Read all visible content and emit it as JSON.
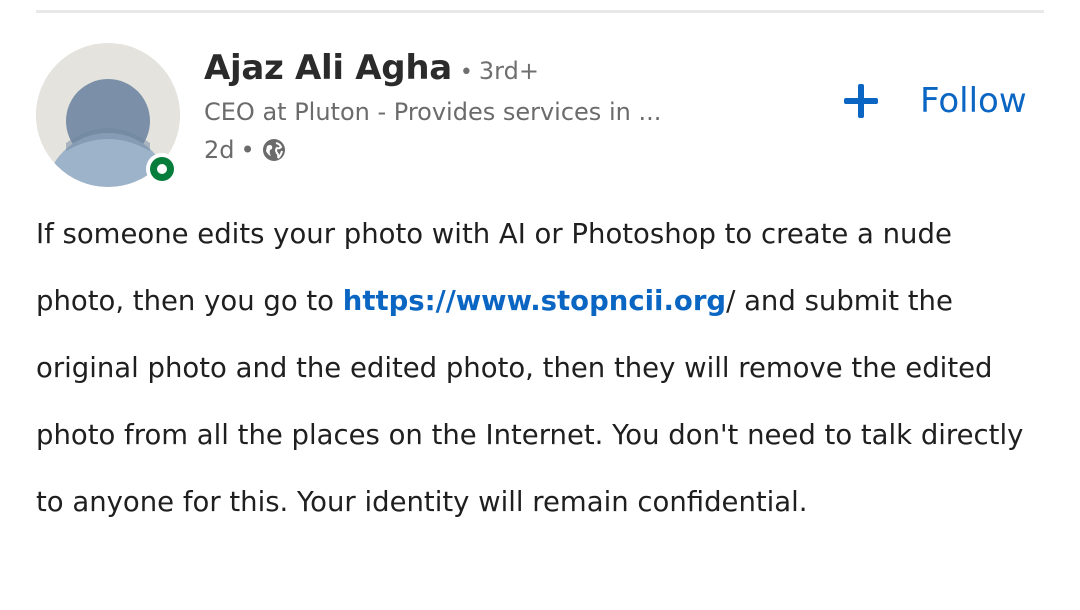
{
  "post": {
    "author": {
      "name": "Ajaz Ali Agha",
      "degree_separator": "•",
      "degree": "3rd+",
      "headline": "CEO at Pluton - Provides services in ...",
      "time_ago": "2d",
      "time_separator": "•",
      "visibility_icon": "globe-icon",
      "presence_status": "online"
    },
    "follow": {
      "icon": "plus-icon",
      "label": "Follow"
    },
    "body": {
      "text_before_link": "If someone edits your photo with AI or Photoshop to create a nude photo, then you go to ",
      "link_text": "https://www.stopncii.org",
      "text_after_link": "/ and submit the original photo and the edited photo, then they will remove the edited photo from all the places on the Internet. You don't need to talk directly to anyone for this. Your identity will remain confidential."
    }
  },
  "colors": {
    "link": "#0a66c2",
    "presence": "#067d3a",
    "avatar_bg": "#e5e3de"
  }
}
